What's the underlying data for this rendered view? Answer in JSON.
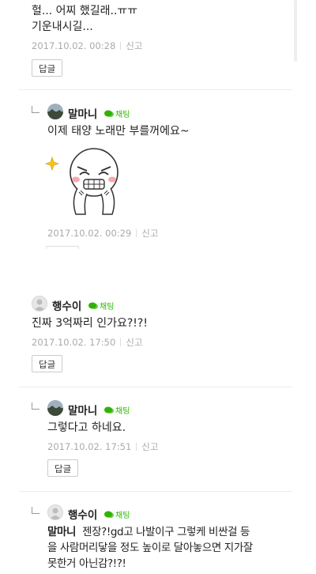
{
  "comments": [
    {
      "text_lines": [
        "헐... 어찌 했길래..ㅠㅠ",
        "기운내시길..."
      ],
      "date": "2017.10.02. 00:28",
      "report_label": "신고",
      "reply_label": "답글"
    },
    {
      "nickname": "말마니",
      "chat_label": "채팅",
      "text": "이제 태양 노래만 부를꺼에요~",
      "date": "2017.10.02. 00:29",
      "report_label": "신고"
    },
    {
      "nickname": "행수이",
      "chat_label": "채팅",
      "text": "진짜 3억짜리 인가요?!?!",
      "date": "2017.10.02. 17:50",
      "report_label": "신고",
      "reply_label": "답글"
    },
    {
      "nickname": "말마니",
      "chat_label": "채팅",
      "text": "그렇다고 하네요.",
      "date": "2017.10.02. 17:51",
      "report_label": "신고",
      "reply_label": "답글"
    },
    {
      "nickname": "행수이",
      "chat_label": "채팅",
      "mention": "말마니",
      "text_lines": [
        "젠장?!gd고 나발이구 그렇케 비싼걸 등",
        "을 사람머리닿을 정도 높이로 달아놓으면 지가잘",
        "못한거 아닌감?!?!"
      ]
    }
  ],
  "colors": {
    "chat_green": "#2db400",
    "meta_gray": "#aaaaaa",
    "divider": "#ececec"
  },
  "icons": {
    "chat": "chat-bubble-icon",
    "reply": "reply-arrow-icon",
    "avatar_landscape": "landscape-avatar-icon",
    "avatar_default": "default-user-avatar-icon",
    "sticker": "crying-face-sticker"
  }
}
